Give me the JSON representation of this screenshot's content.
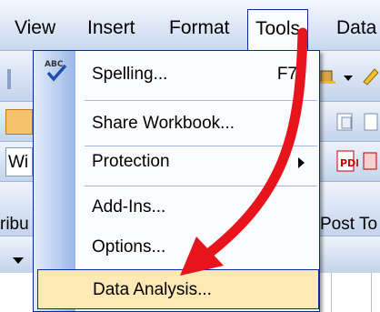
{
  "menubar": {
    "items": [
      {
        "label": "View"
      },
      {
        "label": "Insert"
      },
      {
        "label": "Format"
      },
      {
        "label": "Tools"
      },
      {
        "label": "Data"
      }
    ]
  },
  "background": {
    "name_box_fragment": "Wi",
    "toolbar_fragment_left": "ribu",
    "toolbar_fragment_right": "Post To"
  },
  "tools_menu": {
    "items": [
      {
        "label": "Spelling...",
        "shortcut": "F7",
        "icon": "spelling-abc-check-icon"
      },
      {
        "label": "Share Workbook..."
      },
      {
        "label": "Protection",
        "has_submenu": true
      },
      {
        "label": "Add-Ins..."
      },
      {
        "label": "Options..."
      },
      {
        "label": "Data Analysis...",
        "highlighted": true
      }
    ]
  },
  "annotation": {
    "arrow_color": "#e8141b",
    "icon": "red-arrow-pointer-icon"
  },
  "colors": {
    "menu_highlight": "#fce9b6",
    "menu_border": "#002d96"
  }
}
